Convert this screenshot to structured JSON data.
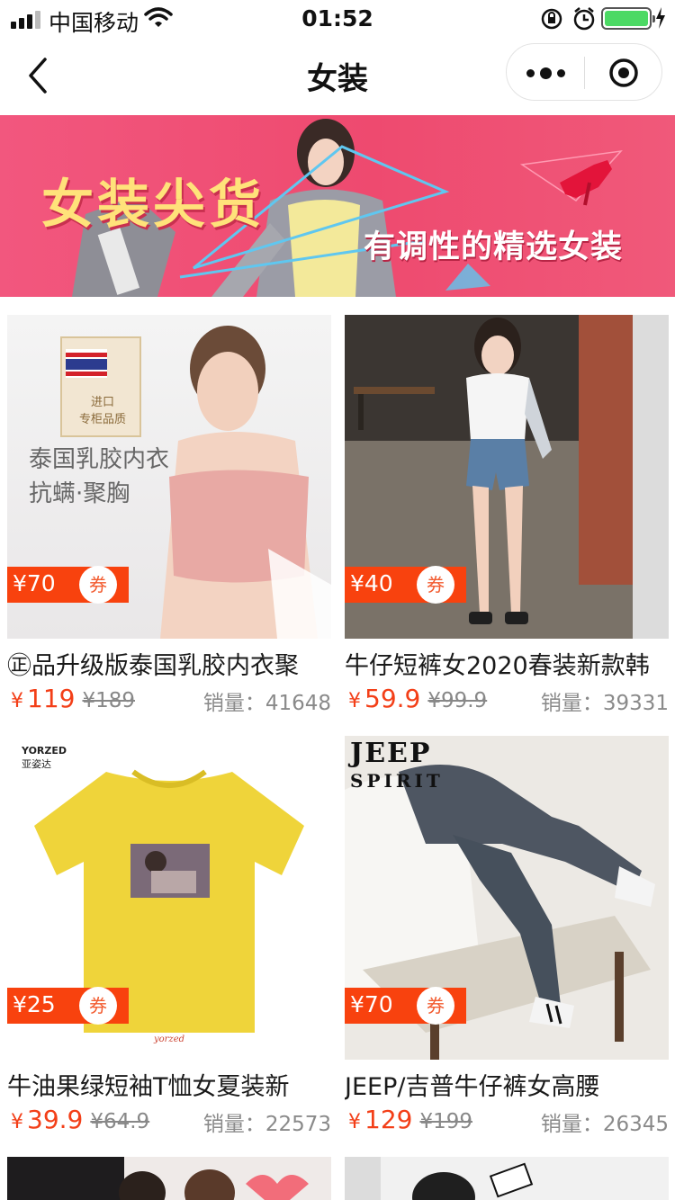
{
  "status_bar": {
    "carrier": "中国移动",
    "time": "01:52"
  },
  "nav": {
    "title": "女装"
  },
  "banner": {
    "title": "女装尖货",
    "subtitle": "有调性的精选女装"
  },
  "products": [
    {
      "title": "㊣品升级版泰国乳胶内衣聚",
      "coupon_price": "¥70",
      "coupon_label": "券",
      "price_currency": "¥",
      "price": "119",
      "original_price": "¥189",
      "sales_label": "销量：",
      "sales": "41648",
      "image_text": {
        "badge": "进口\n专柜品质",
        "line1": "泰国乳胶内衣",
        "line2": "抗螨·聚胸"
      }
    },
    {
      "title": "牛仔短裤女2020春装新款韩",
      "coupon_price": "¥40",
      "coupon_label": "券",
      "price_currency": "¥",
      "price": "59.9",
      "original_price": "¥99.9",
      "sales_label": "销量：",
      "sales": "39331"
    },
    {
      "title": "牛油果绿短袖T恤女夏装新",
      "coupon_price": "¥25",
      "coupon_label": "券",
      "price_currency": "¥",
      "price": "39.9",
      "original_price": "¥64.9",
      "sales_label": "销量：",
      "sales": "22573",
      "image_text": {
        "brand": "YORZED",
        "brand_cn": "亚姿达"
      }
    },
    {
      "title": "JEEP/吉普牛仔裤女高腰",
      "coupon_price": "¥70",
      "coupon_label": "券",
      "price_currency": "¥",
      "price": "129",
      "original_price": "¥199",
      "sales_label": "销量：",
      "sales": "26345",
      "image_text": {
        "brand_line1": "JEEP",
        "brand_line2": "SPIRIT"
      }
    }
  ],
  "colors": {
    "accent_red": "#f33f18",
    "coupon_bg": "#f8420e",
    "banner_pink": "#ee4a6f",
    "banner_title": "#ffe27a"
  }
}
